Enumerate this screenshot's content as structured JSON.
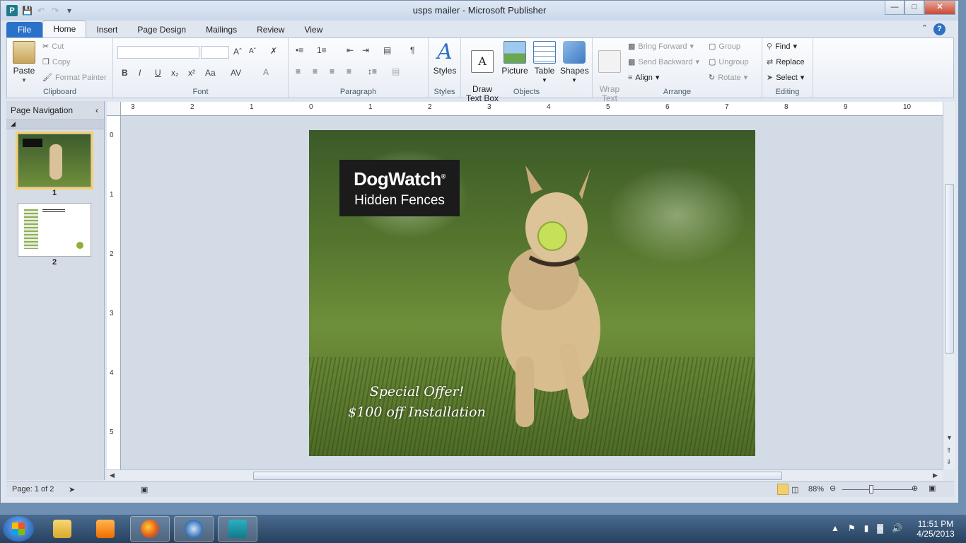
{
  "window": {
    "title": "usps mailer  -  Microsoft Publisher",
    "app_icon_letter": "P",
    "controls": {
      "minimize": "—",
      "maximize": "□",
      "close": "✕"
    }
  },
  "ribbon": {
    "tabs": [
      "File",
      "Home",
      "Insert",
      "Page Design",
      "Mailings",
      "Review",
      "View"
    ],
    "active_tab": "Home",
    "clipboard": {
      "label": "Clipboard",
      "paste": "Paste",
      "cut": "Cut",
      "copy": "Copy",
      "format_painter": "Format Painter"
    },
    "font": {
      "label": "Font"
    },
    "paragraph": {
      "label": "Paragraph"
    },
    "styles": {
      "label": "Styles",
      "button": "Styles"
    },
    "objects": {
      "label": "Objects",
      "draw_text_box": "Draw\nText Box",
      "picture": "Picture",
      "table": "Table",
      "shapes": "Shapes"
    },
    "arrange": {
      "label": "Arrange",
      "wrap_text": "Wrap\nText",
      "bring_forward": "Bring Forward",
      "send_backward": "Send Backward",
      "align": "Align",
      "group": "Group",
      "ungroup": "Ungroup",
      "rotate": "Rotate"
    },
    "editing": {
      "label": "Editing",
      "find": "Find",
      "replace": "Replace",
      "select": "Select"
    }
  },
  "nav_pane": {
    "title": "Page Navigation",
    "pages": [
      {
        "num": "1",
        "selected": true
      },
      {
        "num": "2",
        "selected": false
      }
    ]
  },
  "rulers": {
    "horizontal": [
      "3",
      "2",
      "1",
      "0",
      "1",
      "2",
      "3",
      "4",
      "5",
      "6",
      "7",
      "8",
      "9",
      "10"
    ],
    "vertical": [
      "0",
      "1",
      "2",
      "3",
      "4",
      "5"
    ]
  },
  "document": {
    "logo_main": "DogWatch",
    "logo_mark": "®",
    "logo_sub": "Hidden Fences",
    "offer_line1": "Special Offer!",
    "offer_line2": "$100 off Installation"
  },
  "status": {
    "page": "Page: 1 of 2",
    "zoom": "88%"
  },
  "taskbar": {
    "time": "11:51 PM",
    "date": "4/25/2013"
  },
  "colors": {
    "file_tab": "#2a72c9",
    "selected_thumb": "#f3d06e",
    "logo_bg": "#1b1b1b"
  }
}
